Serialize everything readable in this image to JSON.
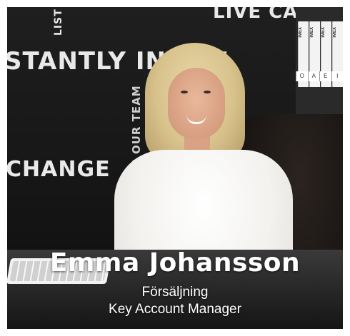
{
  "person": {
    "name": "Emma Johansson",
    "department": "Försäljning",
    "title": "Key Account Manager"
  },
  "background": {
    "wall_texts": [
      "STANTLY INNOV",
      "CHANGE",
      "LIVE CARE",
      "LIST",
      "OP OUR TEAM"
    ],
    "binder_label": "IMEX",
    "binder_caps": [
      "O",
      "A",
      "E",
      "I"
    ]
  },
  "colors": {
    "caption_text": "#ffffff",
    "wall": "#1d1d1d"
  }
}
